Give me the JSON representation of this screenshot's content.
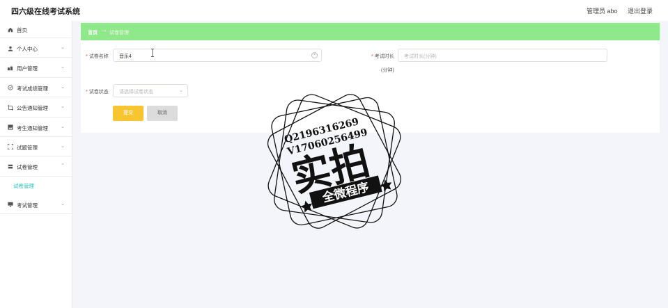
{
  "app": {
    "title": "四六级在线考试系统",
    "user_label": "管理员 abo",
    "logout_label": "退出登录"
  },
  "sidebar": {
    "items": [
      {
        "label": "首页",
        "icon": "home-icon"
      },
      {
        "label": "个人中心",
        "icon": "user-icon"
      },
      {
        "label": "用户管理",
        "icon": "users-icon"
      },
      {
        "label": "考试成绩管理",
        "icon": "score-icon"
      },
      {
        "label": "公告通知管理",
        "icon": "crop-icon"
      },
      {
        "label": "考生通知管理",
        "icon": "image-icon"
      },
      {
        "label": "试题管理",
        "icon": "expand-icon"
      },
      {
        "label": "试卷管理",
        "icon": "stack-icon"
      },
      {
        "label": "考试管理",
        "icon": "monitor-icon"
      }
    ],
    "submenu_label": "试卷管理"
  },
  "breadcrumb": {
    "home": "首页",
    "arrow": "→",
    "current": "试卷管理"
  },
  "form": {
    "name_label": "试卷名称",
    "name_value": "音乐4",
    "duration_label": "考试时长",
    "duration_placeholder": "考试时长(分钟)",
    "duration_unit": "(分钟)",
    "status_label": "试卷状态",
    "status_placeholder": "请选择试卷状态",
    "submit_label": "提交",
    "cancel_label": "取消",
    "required_mark": "*"
  },
  "watermark": {
    "line1": "Q2196316269",
    "line2": "V17060256499",
    "big": "实拍",
    "banner": "全微程序"
  }
}
